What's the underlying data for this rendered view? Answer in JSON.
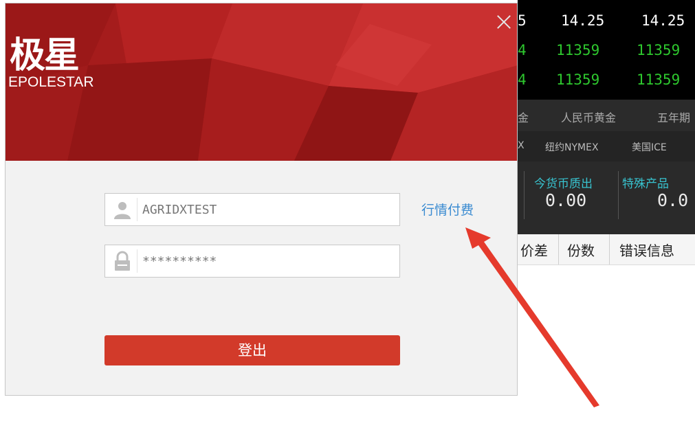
{
  "quotes": {
    "rows": [
      {
        "c1": "5",
        "c2": "14.25",
        "c3": "14.25",
        "color": "#ffffff"
      },
      {
        "c1": "4",
        "c2": "11359",
        "c3": "11359",
        "color": "#2ec82e"
      },
      {
        "c1": "4",
        "c2": "11359",
        "c3": "11359",
        "color": "#2ec82e"
      }
    ]
  },
  "market_tabs": [
    "金",
    "人民币黄金",
    "五年期"
  ],
  "exchange_tabs": [
    "X",
    "纽约NYMEX",
    "美国ICE"
  ],
  "values": [
    {
      "label": "今货币质出",
      "value": "0.00"
    },
    {
      "label": "特殊产品",
      "value": "0.0"
    }
  ],
  "table_headers": [
    "价差",
    "份数",
    "错误信息"
  ],
  "login": {
    "logo_cn": "极星",
    "logo_en": "EPOLESTAR",
    "username": "AGRIDXTEST",
    "password": "**********",
    "pay_link": "行情付费",
    "logout_label": "登出",
    "brand_color": "#a51c1c",
    "button_color": "#d23a2a",
    "link_color": "#3a8bd1"
  }
}
